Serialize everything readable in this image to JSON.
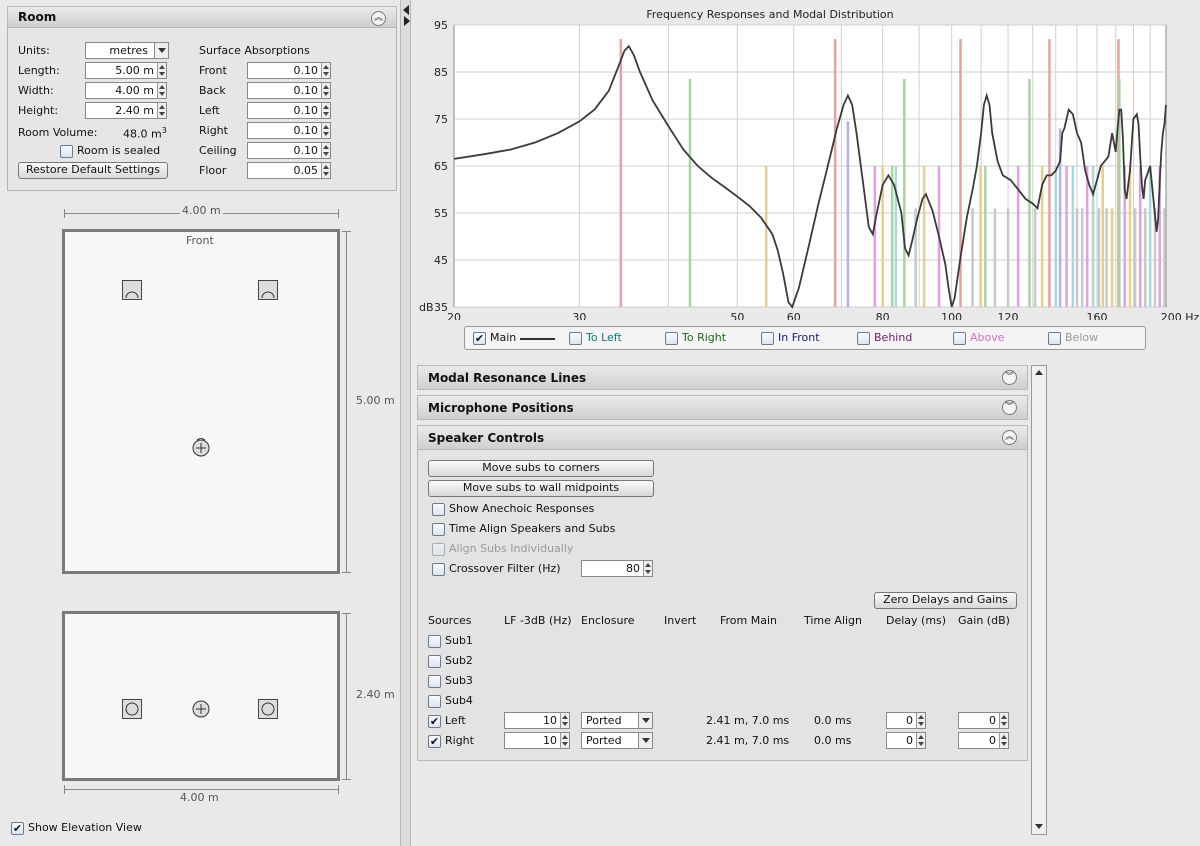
{
  "room_panel": {
    "title": "Room",
    "units_label": "Units:",
    "units_value": "metres",
    "length_label": "Length:",
    "length_value": "5.00 m",
    "width_label": "Width:",
    "width_value": "4.00 m",
    "height_label": "Height:",
    "height_value": "2.40 m",
    "volume_label": "Room Volume:",
    "volume_value": "48.0 m",
    "volume_exp": "3",
    "sealed_label": "Room is sealed",
    "restore_label": "Restore Default Settings",
    "absorptions_title": "Surface Absorptions",
    "absorptions": [
      {
        "label": "Front",
        "value": "0.10"
      },
      {
        "label": "Back",
        "value": "0.10"
      },
      {
        "label": "Left",
        "value": "0.10"
      },
      {
        "label": "Right",
        "value": "0.10"
      },
      {
        "label": "Ceiling",
        "value": "0.10"
      },
      {
        "label": "Floor",
        "value": "0.05"
      }
    ]
  },
  "plan_view": {
    "width_dim": "4.00 m",
    "length_dim": "5.00 m",
    "front_label": "Front"
  },
  "elevation_view": {
    "height_dim": "2.40 m",
    "width_dim": "4.00 m",
    "show_label": "Show Elevation View",
    "show_checked": true
  },
  "chart_data": {
    "type": "line",
    "title": "Frequency Responses and Modal Distribution",
    "ylabel": "dB",
    "xunit": "Hz",
    "xscale": "log",
    "xlim": [
      20,
      200
    ],
    "ylim": [
      35,
      95
    ],
    "yticks": [
      35,
      45,
      55,
      65,
      75,
      85,
      95
    ],
    "xticks": [
      20,
      30,
      40,
      50,
      60,
      80,
      100,
      120,
      160,
      200
    ],
    "xtick_labels": [
      "20",
      "30",
      "",
      "50",
      "60",
      "80",
      "100",
      "120",
      "160",
      "200 Hz"
    ],
    "series": [
      {
        "name": "Main",
        "color": "#3a3a3a",
        "points": [
          [
            20,
            66.5
          ],
          [
            22,
            67.5
          ],
          [
            24,
            68.5
          ],
          [
            26,
            70
          ],
          [
            28,
            72
          ],
          [
            30,
            74.5
          ],
          [
            31.5,
            77
          ],
          [
            33,
            81
          ],
          [
            34,
            86
          ],
          [
            34.7,
            89.5
          ],
          [
            35.2,
            90.5
          ],
          [
            35.8,
            88.5
          ],
          [
            36.5,
            85
          ],
          [
            38,
            79
          ],
          [
            40,
            73.5
          ],
          [
            42,
            68.5
          ],
          [
            44,
            65
          ],
          [
            46,
            62.5
          ],
          [
            48,
            60.5
          ],
          [
            50,
            58.5
          ],
          [
            52,
            56.5
          ],
          [
            54,
            54
          ],
          [
            56,
            50.5
          ],
          [
            57,
            47
          ],
          [
            58,
            42
          ],
          [
            59,
            36
          ],
          [
            59.7,
            35
          ],
          [
            61,
            39
          ],
          [
            63,
            48
          ],
          [
            65,
            57
          ],
          [
            67,
            65
          ],
          [
            69,
            73
          ],
          [
            70.5,
            78
          ],
          [
            71.5,
            80
          ],
          [
            72.5,
            78
          ],
          [
            73.5,
            72
          ],
          [
            75,
            62
          ],
          [
            76.5,
            52
          ],
          [
            77.5,
            50.5
          ],
          [
            78.5,
            55
          ],
          [
            80,
            61
          ],
          [
            81.5,
            63
          ],
          [
            83,
            61
          ],
          [
            85,
            55
          ],
          [
            86,
            47.5
          ],
          [
            87,
            46
          ],
          [
            88,
            49
          ],
          [
            89.5,
            54
          ],
          [
            91,
            58
          ],
          [
            92,
            59
          ],
          [
            94,
            55.5
          ],
          [
            96,
            50
          ],
          [
            98,
            44
          ],
          [
            99,
            39
          ],
          [
            100,
            35
          ],
          [
            101,
            37
          ],
          [
            103,
            46
          ],
          [
            105,
            54
          ],
          [
            107,
            60
          ],
          [
            108.5,
            65
          ],
          [
            110,
            72
          ],
          [
            111,
            78
          ],
          [
            112,
            80
          ],
          [
            113,
            78
          ],
          [
            114,
            72
          ],
          [
            116,
            66
          ],
          [
            118,
            63
          ],
          [
            121,
            62
          ],
          [
            124,
            60
          ],
          [
            127,
            58
          ],
          [
            130,
            57
          ],
          [
            132,
            56
          ],
          [
            134,
            61
          ],
          [
            136,
            63
          ],
          [
            138,
            63
          ],
          [
            140,
            64
          ],
          [
            142,
            66
          ],
          [
            143,
            72
          ],
          [
            144,
            73
          ],
          [
            146,
            77
          ],
          [
            148,
            76
          ],
          [
            150,
            72
          ],
          [
            152,
            70
          ],
          [
            154,
            64
          ],
          [
            156,
            61
          ],
          [
            158,
            59
          ],
          [
            160,
            62
          ],
          [
            162,
            65
          ],
          [
            164,
            66
          ],
          [
            166,
            67
          ],
          [
            168,
            72
          ],
          [
            170,
            68
          ],
          [
            171,
            73
          ],
          [
            172,
            77
          ],
          [
            173,
            77
          ],
          [
            174,
            71
          ],
          [
            175,
            60
          ],
          [
            176,
            58
          ],
          [
            178,
            64
          ],
          [
            180,
            75
          ],
          [
            182,
            76
          ],
          [
            183,
            74
          ],
          [
            184,
            67
          ],
          [
            185,
            61
          ],
          [
            186,
            58
          ],
          [
            187,
            62
          ],
          [
            188,
            63
          ],
          [
            190,
            65
          ],
          [
            192,
            58
          ],
          [
            194,
            51
          ],
          [
            195,
            54
          ],
          [
            196,
            62
          ],
          [
            197,
            68
          ],
          [
            198,
            72
          ],
          [
            199,
            74
          ],
          [
            200,
            78
          ]
        ]
      }
    ],
    "modal_lines_colors": {
      "axial_length": "#e8a0a0",
      "axial_width": "#a8d4a0",
      "axial_height": "#e4d08c",
      "tangential": "#b0b0f0",
      "tangential_b": "#e0a0e8",
      "oblique": "#c8c8c8",
      "mixed": "#a8d8d8"
    },
    "modal_lines": [
      {
        "f": 34.3,
        "h": 92,
        "c": "axial_length"
      },
      {
        "f": 42.9,
        "h": 83.5,
        "c": "axial_width"
      },
      {
        "f": 54.9,
        "h": 65,
        "c": "axial_height"
      },
      {
        "f": 68.6,
        "h": 92,
        "c": "axial_length"
      },
      {
        "f": 71.5,
        "h": 74.5,
        "c": "tangential"
      },
      {
        "f": 78,
        "h": 65,
        "c": "tangential_b"
      },
      {
        "f": 80,
        "h": 65,
        "c": "axial_height"
      },
      {
        "f": 82.5,
        "h": 65,
        "c": "axial_width"
      },
      {
        "f": 85.8,
        "h": 83.5,
        "c": "axial_width"
      },
      {
        "f": 83.5,
        "h": 65,
        "c": "mixed"
      },
      {
        "f": 89,
        "h": 56,
        "c": "oblique"
      },
      {
        "f": 91.5,
        "h": 65,
        "c": "axial_height"
      },
      {
        "f": 96,
        "h": 65,
        "c": "tangential_b"
      },
      {
        "f": 102.9,
        "h": 92,
        "c": "axial_length"
      },
      {
        "f": 107,
        "h": 56,
        "c": "oblique"
      },
      {
        "f": 109.8,
        "h": 65,
        "c": "axial_height"
      },
      {
        "f": 111.5,
        "h": 65,
        "c": "axial_width"
      },
      {
        "f": 115,
        "h": 56,
        "c": "oblique"
      },
      {
        "f": 120,
        "h": 56,
        "c": "oblique"
      },
      {
        "f": 124,
        "h": 65,
        "c": "tangential_b"
      },
      {
        "f": 128.6,
        "h": 83.5,
        "c": "axial_width"
      },
      {
        "f": 131,
        "h": 56,
        "c": "oblique"
      },
      {
        "f": 134,
        "h": 65,
        "c": "axial_height"
      },
      {
        "f": 137.2,
        "h": 92,
        "c": "axial_length"
      },
      {
        "f": 140,
        "h": 65,
        "c": "mixed"
      },
      {
        "f": 142,
        "h": 73,
        "c": "tangential"
      },
      {
        "f": 145,
        "h": 65,
        "c": "tangential_b"
      },
      {
        "f": 148,
        "h": 65,
        "c": "mixed"
      },
      {
        "f": 150,
        "h": 56,
        "c": "oblique"
      },
      {
        "f": 152.5,
        "h": 56,
        "c": "oblique"
      },
      {
        "f": 155,
        "h": 65,
        "c": "tangential_b"
      },
      {
        "f": 158,
        "h": 65,
        "c": "mixed"
      },
      {
        "f": 161,
        "h": 56,
        "c": "oblique"
      },
      {
        "f": 163,
        "h": 65,
        "c": "axial_height"
      },
      {
        "f": 165,
        "h": 56,
        "c": "oblique"
      },
      {
        "f": 168,
        "h": 56,
        "c": "axial_height"
      },
      {
        "f": 171.5,
        "h": 92,
        "c": "axial_length"
      },
      {
        "f": 172,
        "h": 83.5,
        "c": "axial_width"
      },
      {
        "f": 175,
        "h": 65,
        "c": "tangential_b"
      },
      {
        "f": 178,
        "h": 65,
        "c": "axial_height"
      },
      {
        "f": 181,
        "h": 56,
        "c": "oblique"
      },
      {
        "f": 184,
        "h": 65,
        "c": "tangential_b"
      },
      {
        "f": 187,
        "h": 56,
        "c": "oblique"
      },
      {
        "f": 190,
        "h": 65,
        "c": "mixed"
      },
      {
        "f": 193,
        "h": 56,
        "c": "oblique"
      },
      {
        "f": 196,
        "h": 65,
        "c": "tangential_b"
      },
      {
        "f": 199,
        "h": 56,
        "c": "oblique"
      }
    ]
  },
  "legend": {
    "items": [
      {
        "label": "Main",
        "color": "#111111",
        "checked": true
      },
      {
        "label": "To Left",
        "color": "#0a7a7a",
        "checked": false
      },
      {
        "label": "To Right",
        "color": "#1a6a1a",
        "checked": false
      },
      {
        "label": "In Front",
        "color": "#1a1a7a",
        "checked": false
      },
      {
        "label": "Behind",
        "color": "#6a1a6a",
        "checked": false
      },
      {
        "label": "Above",
        "color": "#d070c8",
        "checked": false
      },
      {
        "label": "Below",
        "color": "#999999",
        "checked": false
      }
    ]
  },
  "panels": {
    "modal_lines": "Modal Resonance Lines",
    "mic_positions": "Microphone Positions",
    "speaker_controls": "Speaker Controls"
  },
  "speaker_controls": {
    "move_corners": "Move subs to corners",
    "move_midpoints": "Move subs to wall midpoints",
    "show_anechoic": "Show Anechoic Responses",
    "time_align": "Time Align Speakers and Subs",
    "align_individually": "Align Subs Individually",
    "crossover_label": "Crossover Filter (Hz)",
    "crossover_value": "80",
    "zero_label": "Zero Delays and Gains",
    "headers": [
      "Sources",
      "LF -3dB (Hz)",
      "Enclosure",
      "Invert",
      "From Main",
      "Time Align",
      "Delay (ms)",
      "Gain (dB)"
    ],
    "sources": [
      {
        "name": "Sub1",
        "checked": false
      },
      {
        "name": "Sub2",
        "checked": false
      },
      {
        "name": "Sub3",
        "checked": false
      },
      {
        "name": "Sub4",
        "checked": false
      },
      {
        "name": "Left",
        "checked": true,
        "lf": "10",
        "enclosure": "Ported",
        "from_main": "2.41 m, 7.0 ms",
        "time_align": "0.0 ms",
        "delay": "0",
        "gain": "0"
      },
      {
        "name": "Right",
        "checked": true,
        "lf": "10",
        "enclosure": "Ported",
        "from_main": "2.41 m, 7.0 ms",
        "time_align": "0.0 ms",
        "delay": "0",
        "gain": "0"
      }
    ]
  }
}
